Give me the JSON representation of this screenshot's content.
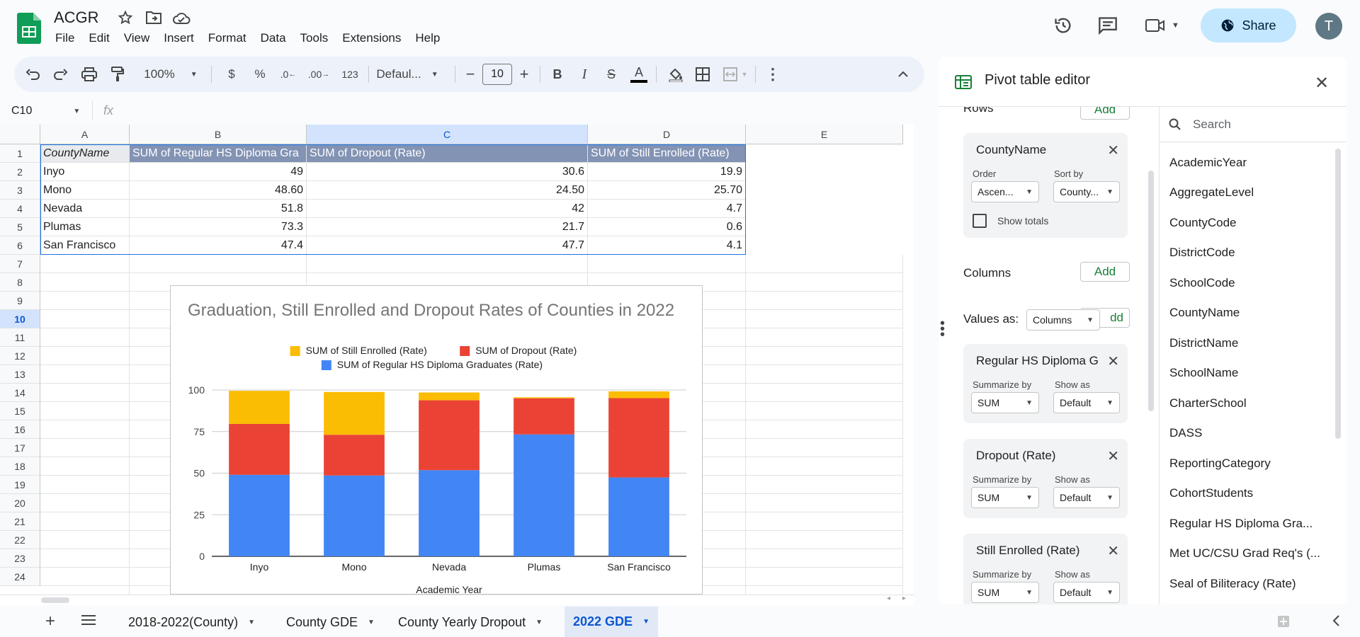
{
  "header": {
    "title": "ACGR",
    "menus": [
      "File",
      "Edit",
      "View",
      "Insert",
      "Format",
      "Data",
      "Tools",
      "Extensions",
      "Help"
    ],
    "share_label": "Share",
    "avatar_letter": "T"
  },
  "toolbar": {
    "zoom": "100%",
    "currency": "$",
    "percent": "%",
    "dec_less": ".0",
    "dec_more": ".00",
    "format_123": "123",
    "font": "Defaul...",
    "font_size": "10",
    "minus": "−",
    "plus": "+"
  },
  "formula": {
    "cell_ref": "C10",
    "fx": "fx"
  },
  "grid": {
    "columns": [
      "A",
      "B",
      "C",
      "D",
      "E"
    ],
    "rows": [
      "1",
      "2",
      "3",
      "4",
      "5",
      "6",
      "7",
      "8",
      "9",
      "10",
      "11",
      "12",
      "13",
      "14",
      "15",
      "16",
      "17",
      "18",
      "19",
      "20",
      "21",
      "22",
      "23",
      "24"
    ],
    "header_row": [
      "CountyName",
      "SUM of Regular HS Diploma Gra",
      "SUM of Dropout (Rate)",
      "SUM of Still Enrolled (Rate)"
    ],
    "data_rows": [
      [
        "Inyo",
        "49",
        "30.6",
        "19.9"
      ],
      [
        "Mono",
        "48.60",
        "24.50",
        "25.70"
      ],
      [
        "Nevada",
        "51.8",
        "42",
        "4.7"
      ],
      [
        "Plumas",
        "73.3",
        "21.7",
        "0.6"
      ],
      [
        "San Francisco",
        "47.4",
        "47.7",
        "4.1"
      ]
    ]
  },
  "chart_data": {
    "type": "bar",
    "stacked": true,
    "title": "Graduation, Still Enrolled and Dropout Rates of Counties in 2022",
    "xlabel": "Academic Year",
    "ylabel": "",
    "categories": [
      "Inyo",
      "Mono",
      "Nevada",
      "Plumas",
      "San Francisco"
    ],
    "ylim": [
      0,
      100
    ],
    "yticks": [
      "0",
      "25",
      "50",
      "75",
      "100"
    ],
    "series": [
      {
        "name": "SUM of Regular HS Diploma Graduates (Rate)",
        "color": "#4285f4",
        "values": [
          49,
          48.6,
          51.8,
          73.3,
          47.4
        ]
      },
      {
        "name": "SUM of Dropout (Rate)",
        "color": "#ea4335",
        "values": [
          30.6,
          24.5,
          42,
          21.7,
          47.7
        ]
      },
      {
        "name": "SUM of Still Enrolled (Rate)",
        "color": "#fbbc04",
        "values": [
          19.9,
          25.7,
          4.7,
          0.6,
          4.1
        ]
      }
    ],
    "legend_order": [
      2,
      1,
      0
    ],
    "legend_position": "top",
    "grid": true
  },
  "tabs": [
    {
      "label": "2018-2022(County)"
    },
    {
      "label": "County GDE"
    },
    {
      "label": "County Yearly Dropout"
    },
    {
      "label": "2022 GDE",
      "active": true
    }
  ],
  "panel": {
    "title": "Pivot table editor",
    "rows_label": "Rows",
    "columns_label": "Columns",
    "values_as_label": "Values as:",
    "values_as_value": "Columns",
    "add_label": "Add",
    "add_partial": "dd",
    "row_card": {
      "title": "CountyName",
      "order_label": "Order",
      "order_value": "Ascen...",
      "sortby_label": "Sort by",
      "sortby_value": "County...",
      "show_totals": "Show totals"
    },
    "value_cards": [
      {
        "title": "Regular HS Diploma G",
        "summarize_label": "Summarize by",
        "summarize_value": "SUM",
        "show_label": "Show as",
        "show_value": "Default"
      },
      {
        "title": "Dropout (Rate)",
        "summarize_label": "Summarize by",
        "summarize_value": "SUM",
        "show_label": "Show as",
        "show_value": "Default"
      },
      {
        "title": "Still Enrolled (Rate)",
        "summarize_label": "Summarize by",
        "summarize_value": "SUM",
        "show_label": "Show as",
        "show_value": "Default"
      }
    ],
    "search_placeholder": "Search",
    "fields": [
      "AcademicYear",
      "AggregateLevel",
      "CountyCode",
      "DistrictCode",
      "SchoolCode",
      "CountyName",
      "DistrictName",
      "SchoolName",
      "CharterSchool",
      "DASS",
      "ReportingCategory",
      "CohortStudents",
      "Regular HS Diploma Gra...",
      "Met UC/CSU Grad Req's (...",
      "Seal of Biliteracy (Rate)"
    ]
  }
}
